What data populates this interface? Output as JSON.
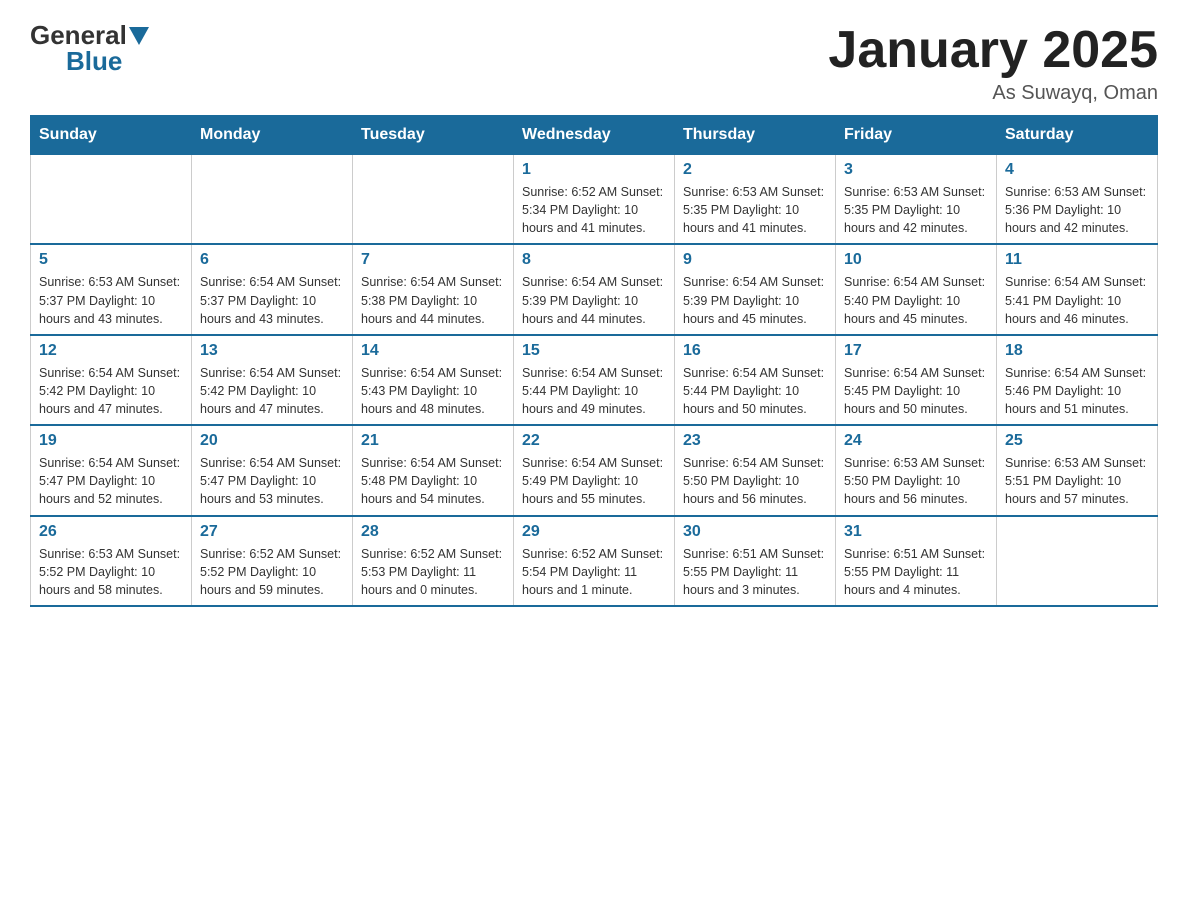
{
  "logo": {
    "general": "General",
    "blue": "Blue"
  },
  "header": {
    "title": "January 2025",
    "subtitle": "As Suwayq, Oman"
  },
  "days_of_week": [
    "Sunday",
    "Monday",
    "Tuesday",
    "Wednesday",
    "Thursday",
    "Friday",
    "Saturday"
  ],
  "weeks": [
    [
      {
        "day": "",
        "info": ""
      },
      {
        "day": "",
        "info": ""
      },
      {
        "day": "",
        "info": ""
      },
      {
        "day": "1",
        "info": "Sunrise: 6:52 AM\nSunset: 5:34 PM\nDaylight: 10 hours and 41 minutes."
      },
      {
        "day": "2",
        "info": "Sunrise: 6:53 AM\nSunset: 5:35 PM\nDaylight: 10 hours and 41 minutes."
      },
      {
        "day": "3",
        "info": "Sunrise: 6:53 AM\nSunset: 5:35 PM\nDaylight: 10 hours and 42 minutes."
      },
      {
        "day": "4",
        "info": "Sunrise: 6:53 AM\nSunset: 5:36 PM\nDaylight: 10 hours and 42 minutes."
      }
    ],
    [
      {
        "day": "5",
        "info": "Sunrise: 6:53 AM\nSunset: 5:37 PM\nDaylight: 10 hours and 43 minutes."
      },
      {
        "day": "6",
        "info": "Sunrise: 6:54 AM\nSunset: 5:37 PM\nDaylight: 10 hours and 43 minutes."
      },
      {
        "day": "7",
        "info": "Sunrise: 6:54 AM\nSunset: 5:38 PM\nDaylight: 10 hours and 44 minutes."
      },
      {
        "day": "8",
        "info": "Sunrise: 6:54 AM\nSunset: 5:39 PM\nDaylight: 10 hours and 44 minutes."
      },
      {
        "day": "9",
        "info": "Sunrise: 6:54 AM\nSunset: 5:39 PM\nDaylight: 10 hours and 45 minutes."
      },
      {
        "day": "10",
        "info": "Sunrise: 6:54 AM\nSunset: 5:40 PM\nDaylight: 10 hours and 45 minutes."
      },
      {
        "day": "11",
        "info": "Sunrise: 6:54 AM\nSunset: 5:41 PM\nDaylight: 10 hours and 46 minutes."
      }
    ],
    [
      {
        "day": "12",
        "info": "Sunrise: 6:54 AM\nSunset: 5:42 PM\nDaylight: 10 hours and 47 minutes."
      },
      {
        "day": "13",
        "info": "Sunrise: 6:54 AM\nSunset: 5:42 PM\nDaylight: 10 hours and 47 minutes."
      },
      {
        "day": "14",
        "info": "Sunrise: 6:54 AM\nSunset: 5:43 PM\nDaylight: 10 hours and 48 minutes."
      },
      {
        "day": "15",
        "info": "Sunrise: 6:54 AM\nSunset: 5:44 PM\nDaylight: 10 hours and 49 minutes."
      },
      {
        "day": "16",
        "info": "Sunrise: 6:54 AM\nSunset: 5:44 PM\nDaylight: 10 hours and 50 minutes."
      },
      {
        "day": "17",
        "info": "Sunrise: 6:54 AM\nSunset: 5:45 PM\nDaylight: 10 hours and 50 minutes."
      },
      {
        "day": "18",
        "info": "Sunrise: 6:54 AM\nSunset: 5:46 PM\nDaylight: 10 hours and 51 minutes."
      }
    ],
    [
      {
        "day": "19",
        "info": "Sunrise: 6:54 AM\nSunset: 5:47 PM\nDaylight: 10 hours and 52 minutes."
      },
      {
        "day": "20",
        "info": "Sunrise: 6:54 AM\nSunset: 5:47 PM\nDaylight: 10 hours and 53 minutes."
      },
      {
        "day": "21",
        "info": "Sunrise: 6:54 AM\nSunset: 5:48 PM\nDaylight: 10 hours and 54 minutes."
      },
      {
        "day": "22",
        "info": "Sunrise: 6:54 AM\nSunset: 5:49 PM\nDaylight: 10 hours and 55 minutes."
      },
      {
        "day": "23",
        "info": "Sunrise: 6:54 AM\nSunset: 5:50 PM\nDaylight: 10 hours and 56 minutes."
      },
      {
        "day": "24",
        "info": "Sunrise: 6:53 AM\nSunset: 5:50 PM\nDaylight: 10 hours and 56 minutes."
      },
      {
        "day": "25",
        "info": "Sunrise: 6:53 AM\nSunset: 5:51 PM\nDaylight: 10 hours and 57 minutes."
      }
    ],
    [
      {
        "day": "26",
        "info": "Sunrise: 6:53 AM\nSunset: 5:52 PM\nDaylight: 10 hours and 58 minutes."
      },
      {
        "day": "27",
        "info": "Sunrise: 6:52 AM\nSunset: 5:52 PM\nDaylight: 10 hours and 59 minutes."
      },
      {
        "day": "28",
        "info": "Sunrise: 6:52 AM\nSunset: 5:53 PM\nDaylight: 11 hours and 0 minutes."
      },
      {
        "day": "29",
        "info": "Sunrise: 6:52 AM\nSunset: 5:54 PM\nDaylight: 11 hours and 1 minute."
      },
      {
        "day": "30",
        "info": "Sunrise: 6:51 AM\nSunset: 5:55 PM\nDaylight: 11 hours and 3 minutes."
      },
      {
        "day": "31",
        "info": "Sunrise: 6:51 AM\nSunset: 5:55 PM\nDaylight: 11 hours and 4 minutes."
      },
      {
        "day": "",
        "info": ""
      }
    ]
  ]
}
